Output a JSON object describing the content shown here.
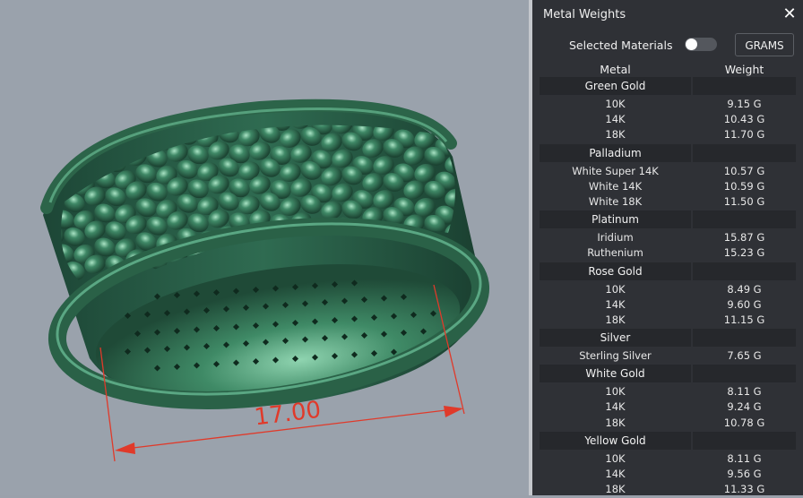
{
  "viewport": {
    "dimension_label": "17.00",
    "colors": {
      "background": "#9aa2ac",
      "ring": "#2f6b4f",
      "dimension": "#e03a2a"
    }
  },
  "panel": {
    "title": "Metal Weights",
    "close_icon": "close-icon",
    "selected_materials_label": "Selected Materials",
    "selected_materials_on": false,
    "units_button": "GRAMS",
    "columns": {
      "metal": "Metal",
      "weight": "Weight"
    },
    "groups": [
      {
        "name": "Green Gold",
        "rows": [
          {
            "metal": "10K",
            "weight": "9.15 G"
          },
          {
            "metal": "14K",
            "weight": "10.43 G"
          },
          {
            "metal": "18K",
            "weight": "11.70 G"
          }
        ]
      },
      {
        "name": "Palladium",
        "rows": [
          {
            "metal": "White Super 14K",
            "weight": "10.57 G"
          },
          {
            "metal": "White 14K",
            "weight": "10.59 G"
          },
          {
            "metal": "White 18K",
            "weight": "11.50 G"
          }
        ]
      },
      {
        "name": "Platinum",
        "rows": [
          {
            "metal": "Iridium",
            "weight": "15.87 G"
          },
          {
            "metal": "Ruthenium",
            "weight": "15.23 G"
          }
        ]
      },
      {
        "name": "Rose Gold",
        "rows": [
          {
            "metal": "10K",
            "weight": "8.49 G"
          },
          {
            "metal": "14K",
            "weight": "9.60 G"
          },
          {
            "metal": "18K",
            "weight": "11.15 G"
          }
        ]
      },
      {
        "name": "Silver",
        "rows": [
          {
            "metal": "Sterling Silver",
            "weight": "7.65 G"
          }
        ]
      },
      {
        "name": "White Gold",
        "rows": [
          {
            "metal": "10K",
            "weight": "8.11 G"
          },
          {
            "metal": "14K",
            "weight": "9.24 G"
          },
          {
            "metal": "18K",
            "weight": "10.78 G"
          }
        ]
      },
      {
        "name": "Yellow Gold",
        "rows": [
          {
            "metal": "10K",
            "weight": "8.11 G"
          },
          {
            "metal": "14K",
            "weight": "9.56 G"
          },
          {
            "metal": "18K",
            "weight": "11.33 G"
          }
        ]
      }
    ]
  }
}
